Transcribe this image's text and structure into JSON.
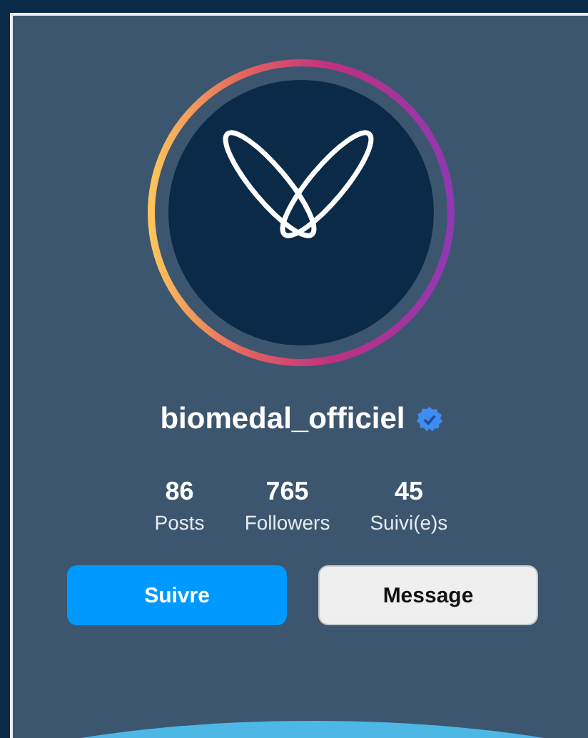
{
  "profile": {
    "username": "biomedal_officiel",
    "verified": true,
    "story_ring": true
  },
  "stats": [
    {
      "value": "86",
      "label": "Posts"
    },
    {
      "value": "765",
      "label": "Followers"
    },
    {
      "value": "45",
      "label": "Suivi(e)s"
    }
  ],
  "buttons": [
    {
      "label": "Suivre",
      "kind": "primary"
    },
    {
      "label": "Message",
      "kind": "secondary"
    }
  ]
}
